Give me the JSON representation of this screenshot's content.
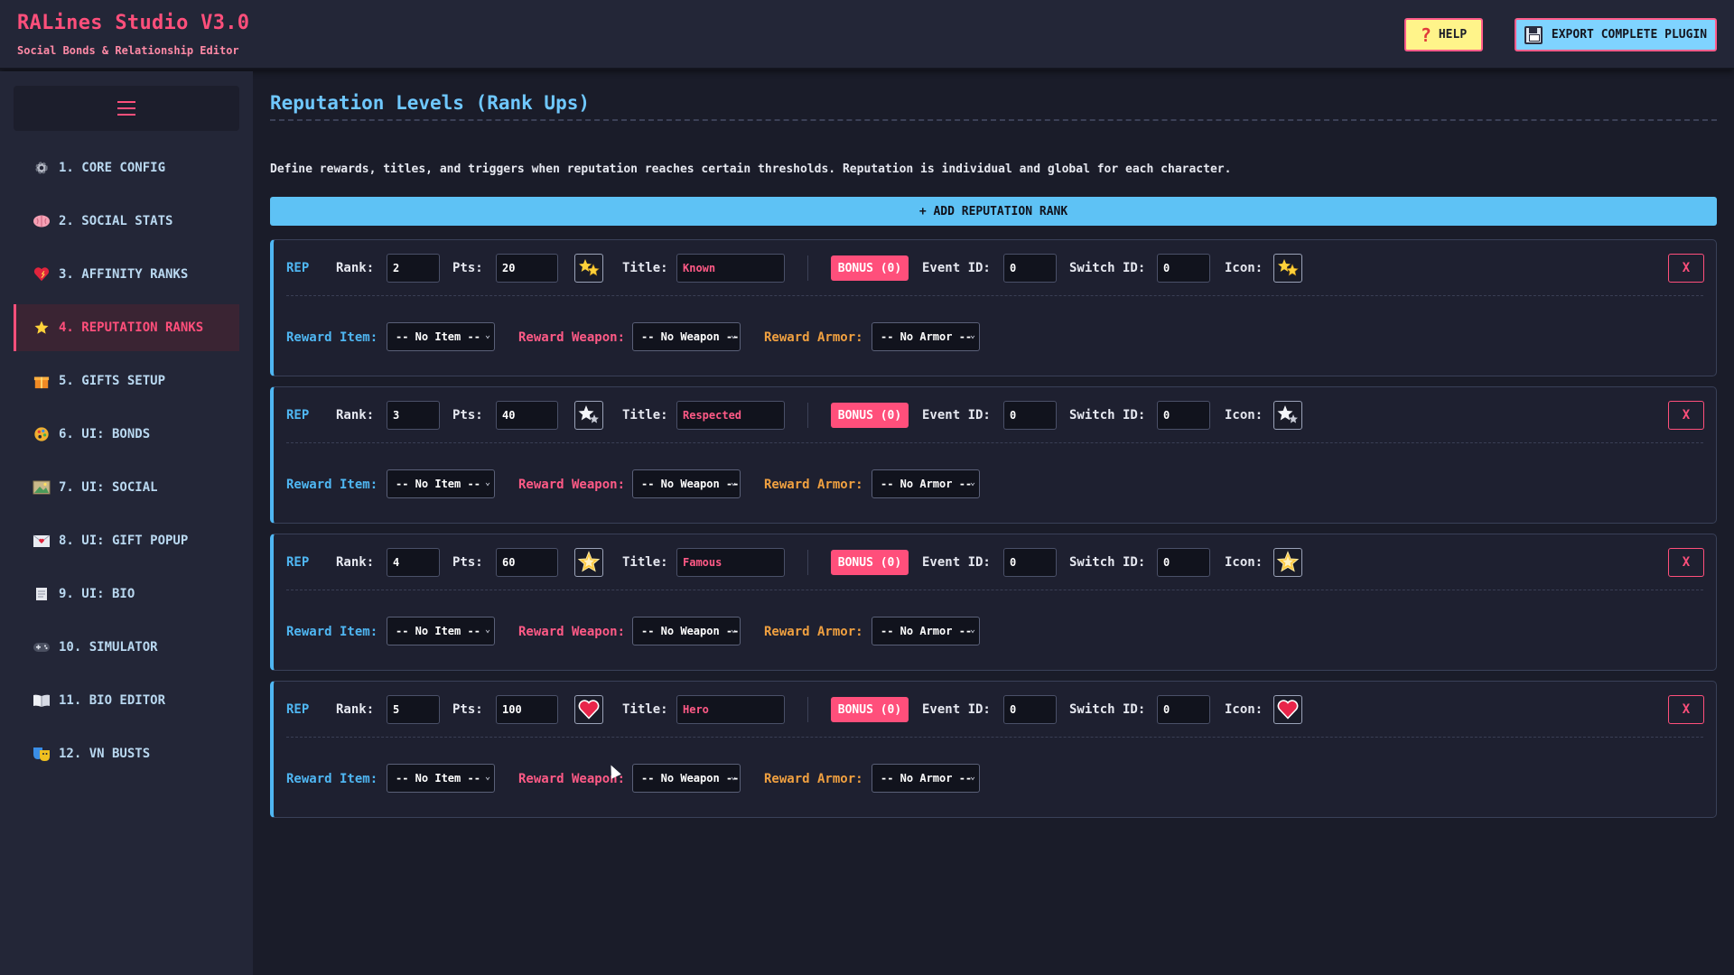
{
  "header": {
    "title": "RALines Studio V3.0",
    "subtitle": "Social Bonds & Relationship Editor",
    "help_label": "HELP",
    "export_label": "EXPORT COMPLETE PLUGIN"
  },
  "sidebar": {
    "items": [
      {
        "label": "1. CORE CONFIG",
        "icon": "gear-icon",
        "active": false
      },
      {
        "label": "2. SOCIAL STATS",
        "icon": "brain-icon",
        "active": false
      },
      {
        "label": "3. AFFINITY RANKS",
        "icon": "heart-icon",
        "active": false
      },
      {
        "label": "4. REPUTATION RANKS",
        "icon": "star-icon",
        "active": true
      },
      {
        "label": "5. GIFTS SETUP",
        "icon": "gift-icon",
        "active": false
      },
      {
        "label": "6. UI: BONDS",
        "icon": "palette-icon",
        "active": false
      },
      {
        "label": "7. UI: SOCIAL",
        "icon": "picture-icon",
        "active": false
      },
      {
        "label": "8. UI: GIFT POPUP",
        "icon": "envelope-icon",
        "active": false
      },
      {
        "label": "9. UI: BIO",
        "icon": "scroll-icon",
        "active": false
      },
      {
        "label": "10. SIMULATOR",
        "icon": "gamepad-icon",
        "active": false
      },
      {
        "label": "11. BIO EDITOR",
        "icon": "book-icon",
        "active": false
      },
      {
        "label": "12. VN BUSTS",
        "icon": "masks-icon",
        "active": false
      }
    ]
  },
  "main": {
    "title": "Reputation Levels (Rank Ups)",
    "description": "Define rewards, titles, and triggers when reputation reaches certain thresholds. Reputation is individual and global for each character.",
    "add_button": "+ ADD REPUTATION RANK",
    "labels": {
      "tag": "REP",
      "rank": "Rank:",
      "pts": "Pts:",
      "title": "Title:",
      "event_id": "Event ID:",
      "switch_id": "Switch ID:",
      "icon": "Icon:",
      "delete": "X",
      "reward_item": "Reward Item:",
      "reward_weapon": "Reward Weapon:",
      "reward_armor": "Reward Armor:"
    },
    "ranks": [
      {
        "rank": "2",
        "pts": "20",
        "title": "Known",
        "bonus": "BONUS (0)",
        "event_id": "0",
        "switch_id": "0",
        "icon": "two-stars-icon",
        "reward_item": "-- No Item --",
        "reward_weapon": "-- No Weapon --",
        "reward_armor": "-- No Armor --"
      },
      {
        "rank": "3",
        "pts": "40",
        "title": "Respected",
        "bonus": "BONUS (0)",
        "event_id": "0",
        "switch_id": "0",
        "icon": "two-white-stars-icon",
        "reward_item": "-- No Item --",
        "reward_weapon": "-- No Weapon --",
        "reward_armor": "-- No Armor --"
      },
      {
        "rank": "4",
        "pts": "60",
        "title": "Famous",
        "bonus": "BONUS (0)",
        "event_id": "0",
        "switch_id": "0",
        "icon": "glowing-star-icon",
        "reward_item": "-- No Item --",
        "reward_weapon": "-- No Weapon --",
        "reward_armor": "-- No Armor --"
      },
      {
        "rank": "5",
        "pts": "100",
        "title": "Hero",
        "bonus": "BONUS (0)",
        "event_id": "0",
        "switch_id": "0",
        "icon": "heart-icon",
        "reward_item": "-- No Item --",
        "reward_weapon": "-- No Weapon --",
        "reward_armor": "-- No Armor --"
      }
    ]
  },
  "colors": {
    "accent_pink": "#ff4f7b",
    "accent_blue": "#4fb6f2",
    "armor_orange": "#f0a040",
    "background": "#1a1c29"
  }
}
